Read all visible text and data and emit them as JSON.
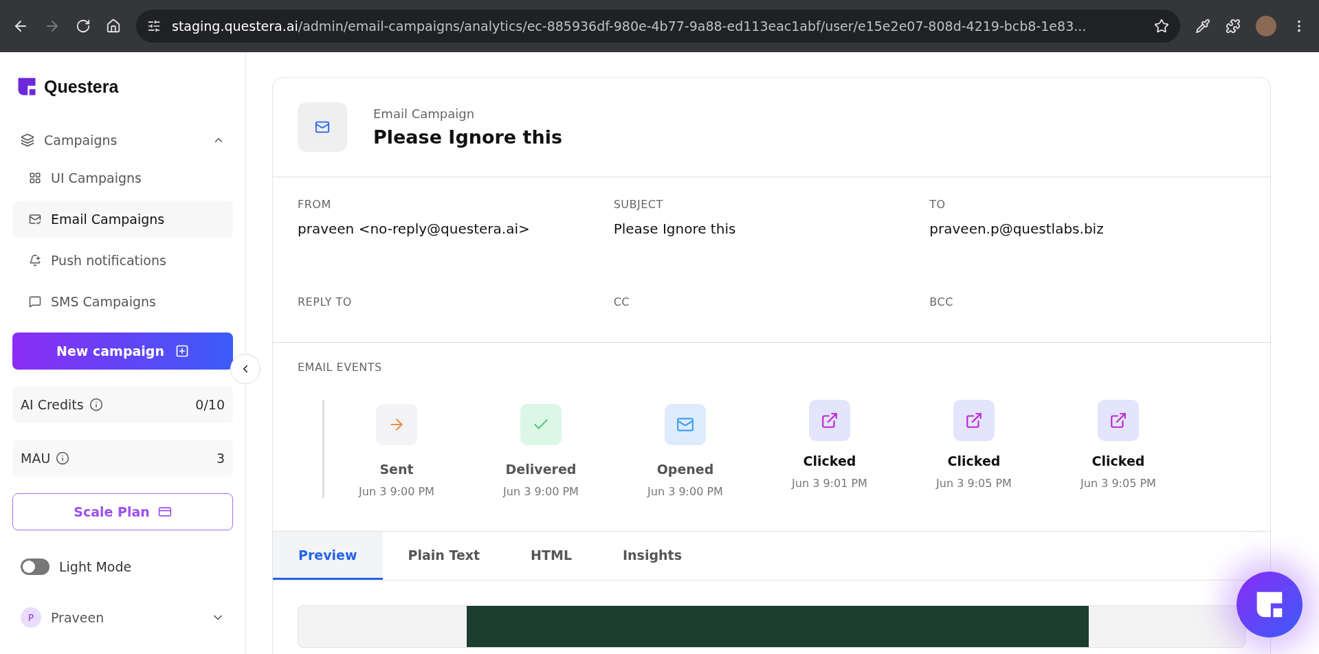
{
  "browser": {
    "url_host": "staging.questera.ai",
    "url_path": "/admin/email-campaigns/analytics/ec-885936df-980e-4b77-9a88-ed113eac1abf/user/e15e2e07-808d-4219-bcb8-1e83..."
  },
  "sidebar": {
    "brand": "Questera",
    "nav": {
      "label": "Campaigns",
      "expanded": true,
      "children": [
        {
          "label": "UI Campaigns",
          "selected": false,
          "kind": "ui"
        },
        {
          "label": "Email Campaigns",
          "selected": true,
          "kind": "email"
        },
        {
          "label": "Push notifications",
          "selected": false,
          "kind": "push"
        },
        {
          "label": "SMS Campaigns",
          "selected": false,
          "kind": "sms"
        }
      ]
    },
    "new_campaign": "New campaign",
    "stats": [
      {
        "label": "AI Credits",
        "value": "0/10"
      },
      {
        "label": "MAU",
        "value": "3"
      }
    ],
    "plan_button": "Scale Plan",
    "theme_toggle": {
      "label": "Light Mode",
      "on": false
    },
    "user": {
      "initial": "P",
      "name": "Praveen"
    }
  },
  "campaign": {
    "type": "Email Campaign",
    "title": "Please Ignore this",
    "fields": [
      {
        "label": "FROM",
        "value": "praveen <no-reply@questera.ai>"
      },
      {
        "label": "SUBJECT",
        "value": "Please Ignore this"
      },
      {
        "label": "TO",
        "value": "praveen.p@questlabs.biz"
      },
      {
        "label": "REPLY TO"
      },
      {
        "label": "CC"
      },
      {
        "label": "BCC"
      }
    ],
    "events_title": "EMAIL EVENTS",
    "events": [
      {
        "kind": "sent",
        "label": "Sent",
        "time": "Jun 3 9:00 PM"
      },
      {
        "kind": "delivered",
        "label": "Delivered",
        "time": "Jun 3 9:00 PM"
      },
      {
        "kind": "opened",
        "label": "Opened",
        "time": "Jun 3 9:00 PM"
      },
      {
        "kind": "clicked",
        "label": "Clicked",
        "time": "Jun 3 9:01 PM"
      },
      {
        "kind": "clicked",
        "label": "Clicked",
        "time": "Jun 3 9:05 PM"
      },
      {
        "kind": "clicked",
        "label": "Clicked",
        "time": "Jun 3 9:05 PM"
      }
    ],
    "tabs": [
      {
        "label": "Preview",
        "selected": true
      },
      {
        "label": "Plain Text",
        "selected": false
      },
      {
        "label": "HTML",
        "selected": false
      },
      {
        "label": "Insights",
        "selected": false
      }
    ]
  }
}
